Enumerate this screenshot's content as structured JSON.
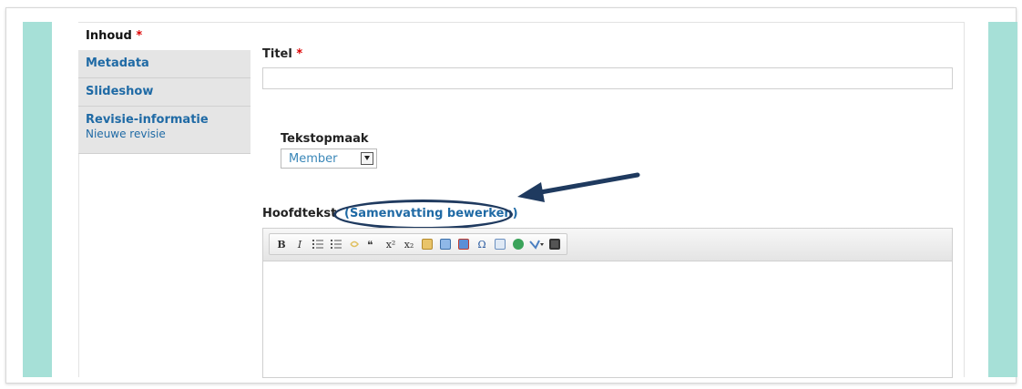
{
  "tabs": [
    {
      "label": "Inhoud",
      "required": "*"
    },
    {
      "label": "Metadata"
    },
    {
      "label": "Slideshow"
    },
    {
      "label": "Revisie-informatie",
      "sub": "Nieuwe revisie"
    }
  ],
  "title_field": {
    "label": "Titel",
    "required": "*",
    "value": ""
  },
  "text_format": {
    "label": "Tekstopmaak",
    "selected": "Member"
  },
  "body_field": {
    "label": "Hoofdtekst",
    "summary_link": "(Samenvatting bewerken)"
  },
  "toolbar": {
    "buttons": [
      "B",
      "I",
      "bulleted-list",
      "numbered-list",
      "outdent",
      "blockquote",
      "superscript",
      "subscript",
      "paste",
      "image",
      "media",
      "special-char",
      "table",
      "globe",
      "spellcheck",
      "fullscreen"
    ],
    "bold_label": "B",
    "italic_label": "I",
    "omega_label": "Ω",
    "sup_label": "x²",
    "sub_label": "x₂"
  },
  "colors": {
    "accent_teal": "#a6e0d7",
    "link_blue": "#1f6aa5",
    "annotation_navy": "#1f3a5f",
    "required_red": "#dd0000"
  }
}
